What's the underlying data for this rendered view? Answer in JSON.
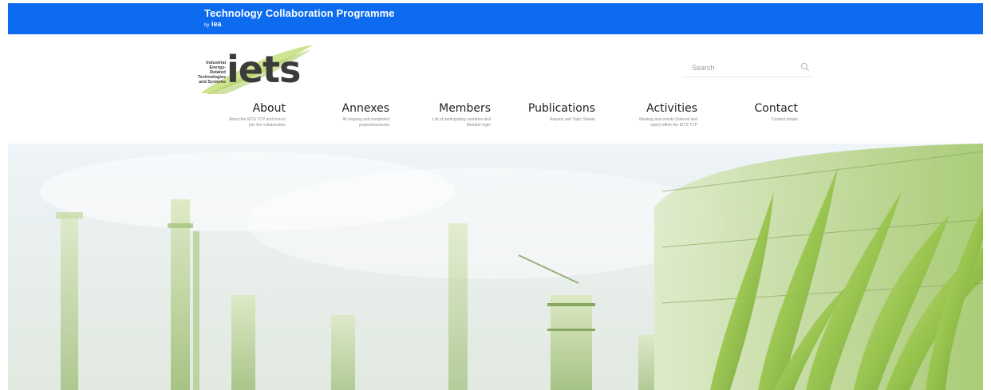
{
  "topbar": {
    "title": "Technology Collaboration Programme",
    "by": "by",
    "org": "iea"
  },
  "logo": {
    "line1": "Industrial",
    "line2": "Energy-Related",
    "line3": "Technologies",
    "line4": "and Systems",
    "word": "iets"
  },
  "search": {
    "placeholder": "Search",
    "icon": "search-icon"
  },
  "nav": [
    {
      "label": "About",
      "desc1": "About the IETS TCP and how to",
      "desc2": "join the collaboration"
    },
    {
      "label": "Annexes",
      "desc1": "All ongoing and completed",
      "desc2": "projects/annexes"
    },
    {
      "label": "Members",
      "desc1": "List of participating countries and",
      "desc2": "Member login"
    },
    {
      "label": "Publications",
      "desc1": "Reports and Topic Sheets",
      "desc2": ""
    },
    {
      "label": "Activities",
      "desc1": "Meeting and events (internal and",
      "desc2": "open) within the IETS TCP"
    },
    {
      "label": "Contact",
      "desc1": "Contact details",
      "desc2": ""
    }
  ],
  "colors": {
    "topbar": "#0d6bf0",
    "logo_green": "#b9d86a",
    "text_dark": "#222222"
  }
}
